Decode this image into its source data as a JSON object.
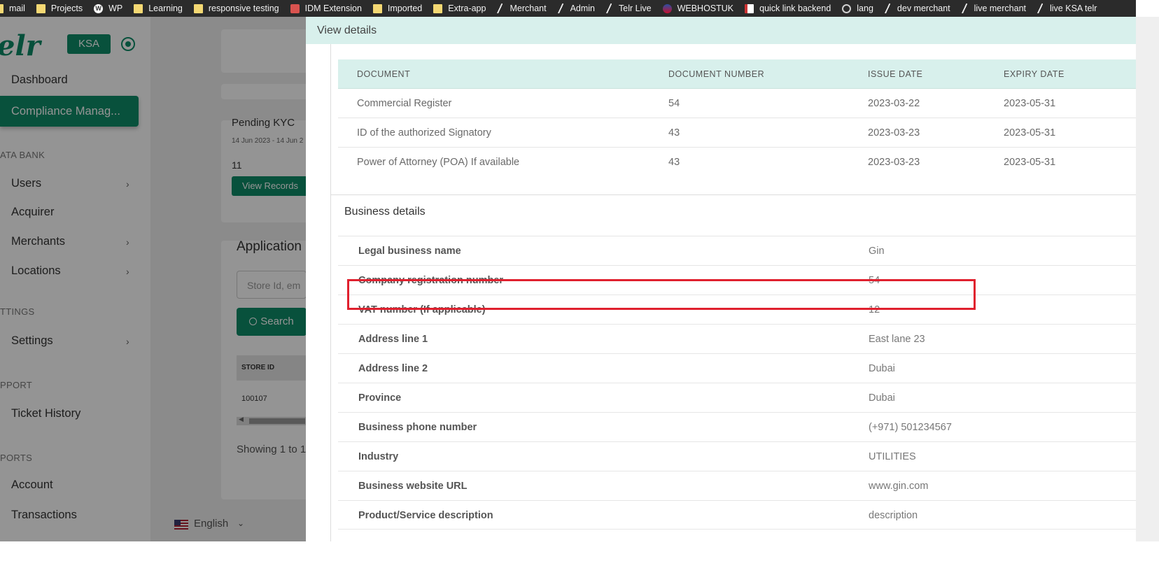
{
  "bookmarks": [
    {
      "label": "mail",
      "icon": "folder-icon"
    },
    {
      "label": "Projects",
      "icon": "folder-icon"
    },
    {
      "label": "WP",
      "icon": "wordpress-icon"
    },
    {
      "label": "Learning",
      "icon": "folder-icon"
    },
    {
      "label": "responsive testing",
      "icon": "folder-icon"
    },
    {
      "label": "IDM Extension",
      "icon": "idm-icon"
    },
    {
      "label": "Imported",
      "icon": "folder-icon"
    },
    {
      "label": "Extra-app",
      "icon": "folder-icon"
    },
    {
      "label": "Merchant",
      "icon": "slash-icon"
    },
    {
      "label": "Admin",
      "icon": "slash-icon"
    },
    {
      "label": "Telr Live",
      "icon": "slash-icon"
    },
    {
      "label": "WEBHOSTUK",
      "icon": "flag-icon"
    },
    {
      "label": "quick link backend",
      "icon": "file-icon"
    },
    {
      "label": "lang",
      "icon": "globe-icon"
    },
    {
      "label": "dev merchant",
      "icon": "slash-icon"
    },
    {
      "label": "live merchant",
      "icon": "slash-icon"
    },
    {
      "label": "live KSA telr",
      "icon": "slash-icon"
    }
  ],
  "sidebar": {
    "logo": "elr",
    "region_badge": "KSA",
    "items": {
      "dashboard": "Dashboard",
      "compliance": "Compliance Manag...",
      "users": "Users",
      "acquirer": "Acquirer",
      "merchants": "Merchants",
      "locations": "Locations",
      "settings": "Settings",
      "ticket_history": "Ticket History",
      "account": "Account",
      "transactions": "Transactions"
    },
    "sections": {
      "data_bank": "ATA BANK",
      "settings": "TTINGS",
      "support": "PPORT",
      "reports": "PORTS"
    }
  },
  "background": {
    "pending_kyc": {
      "title": "Pending KYC",
      "date_range": "14 Jun 2023 - 14 Jun 2",
      "count": "11",
      "button": "View Records"
    },
    "applications": {
      "title": "Application",
      "search_placeholder": "Store Id, em",
      "search_button": "Search",
      "store_id_header": "STORE ID",
      "store_id_value": "100107",
      "showing_text": "Showing 1 to 1"
    },
    "language": "English"
  },
  "drawer": {
    "title": "View details",
    "documents": {
      "headers": [
        "DOCUMENT",
        "DOCUMENT NUMBER",
        "ISSUE DATE",
        "EXPIRY DATE"
      ],
      "rows": [
        {
          "document": "Commercial Register",
          "number": "54",
          "issue": "2023-03-22",
          "expiry": "2023-05-31"
        },
        {
          "document": "ID of the authorized Signatory",
          "number": "43",
          "issue": "2023-03-23",
          "expiry": "2023-05-31"
        },
        {
          "document": "Power of Attorney (POA) If available",
          "number": "43",
          "issue": "2023-03-23",
          "expiry": "2023-05-31"
        }
      ]
    },
    "business": {
      "title": "Business details",
      "rows": [
        {
          "label": "Legal business name",
          "value": "Gin"
        },
        {
          "label": "Company registration number",
          "value": "54"
        },
        {
          "label": "VAT number (If applicable)",
          "value": "12"
        },
        {
          "label": "Address line 1",
          "value": "East lane 23"
        },
        {
          "label": "Address line 2",
          "value": "Dubai"
        },
        {
          "label": "Province",
          "value": "Dubai"
        },
        {
          "label": "Business phone number",
          "value": "(+971) 501234567"
        },
        {
          "label": "Industry",
          "value": "UTILITIES"
        },
        {
          "label": "Business website URL",
          "value": "www.gin.com"
        },
        {
          "label": "Product/Service description",
          "value": "description"
        }
      ]
    }
  },
  "colors": {
    "brand": "#0f8c68",
    "header_tint": "#d8f0ec",
    "highlight": "#e0202e"
  }
}
